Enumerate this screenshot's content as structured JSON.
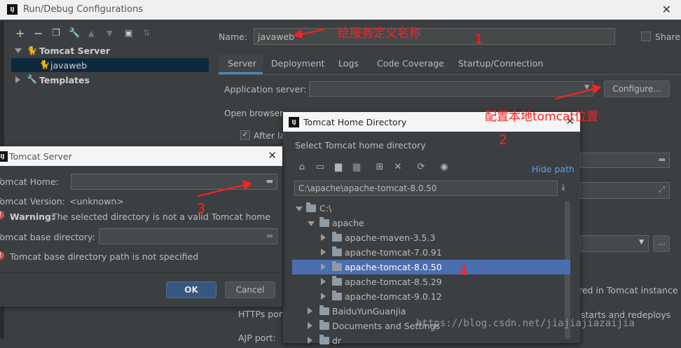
{
  "main_window": {
    "title": "Run/Debug Configurations",
    "toolbar_icons": [
      "plus-icon",
      "minus-icon",
      "copy-icon",
      "wrench-icon",
      "arrow-up-icon",
      "arrow-down-icon",
      "folder-add-icon",
      "sort-icon"
    ],
    "tree": {
      "group": "Tomcat Server",
      "child": "javaweb",
      "templates": "Templates"
    },
    "name_label": "Name:",
    "name_value": "javaweb",
    "share_label": "Share",
    "tabs": [
      "Server",
      "Deployment",
      "Logs",
      "Code Coverage",
      "Startup/Connection"
    ],
    "active_tab": "Server",
    "app_server_label": "Application server:",
    "configure_button": "Configure...",
    "open_browser_label": "Open browser",
    "after_launch": "After la",
    "https_port": "HTTPs port",
    "ajp_port": "AJP port:",
    "right_text_1": "red in Tomcat instance",
    "right_text_2": "starts and redeploys"
  },
  "tomcat_server_dialog": {
    "title": "Tomcat Server",
    "home_label": "Tomcat Home:",
    "version_label": "Tomcat Version:",
    "version_value": "<unknown>",
    "warning_bold": "Warning:",
    "warning_text": "The selected directory is not a valid Tomcat home",
    "base_dir_label": "Tomcat base directory:",
    "base_dir_error": "Tomcat base directory path is not specified",
    "ok_button": "OK",
    "cancel_button": "Cancel"
  },
  "home_dir_dialog": {
    "title": "Tomcat Home Directory",
    "subtitle": "Select Tomcat home directory",
    "hide_path": "Hide path",
    "path_value": "C:\\apache\\apache-tomcat-8.0.50",
    "tree": [
      {
        "label": "C:\\",
        "expanded": true
      },
      {
        "label": "apache",
        "expanded": true
      },
      {
        "label": "apache-maven-3.5.3",
        "expanded": false
      },
      {
        "label": "apache-tomcat-7.0.91",
        "expanded": false
      },
      {
        "label": "apache-tomcat-8.0.50",
        "expanded": false,
        "selected": true
      },
      {
        "label": "apache-tomcat-8.5.29",
        "expanded": false
      },
      {
        "label": "apache-tomcat-9.0.12",
        "expanded": false
      },
      {
        "label": "BaiduYunGuanjia",
        "expanded": false
      },
      {
        "label": "Documents and Settings",
        "expanded": false
      },
      {
        "label": "dr",
        "expanded": false
      }
    ]
  },
  "annotations": {
    "a1_text": "给服务定义名称",
    "a1_num": "1",
    "a2_text": "配置本地tomcat位置",
    "a2_num": "2",
    "a3_num": "3",
    "a4_num": "4"
  },
  "watermark": "https://blog.csdn.net/jiajiajiazaijia",
  "colors": {
    "dark_bg": "#3c3f41",
    "selected": "#4b6eaf",
    "field": "#45494a",
    "annotation": "#ff2020",
    "link": "#589df6"
  }
}
